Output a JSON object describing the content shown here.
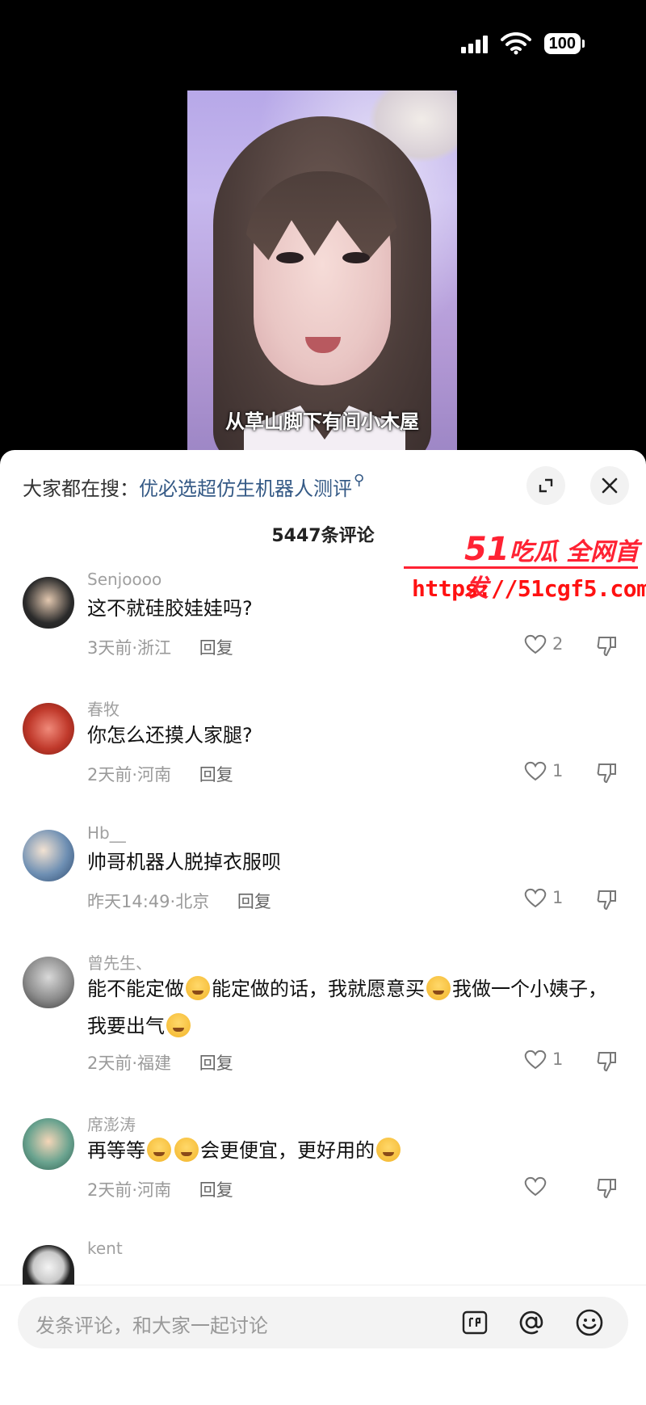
{
  "status": {
    "battery": "100"
  },
  "video": {
    "caption": "从草山脚下有间小木屋"
  },
  "search": {
    "prefix": "大家都在搜：",
    "query": "优必选超仿生机器人测评",
    "search_glyph": "⚲"
  },
  "comments_count": "5447条评论",
  "watermark": {
    "brand_num": "51",
    "brand_text": "吃瓜 全网首发",
    "url": "https://51cgf5.com"
  },
  "comments": [
    {
      "user": "Senjoooo",
      "text": "这不就硅胶娃娃吗?",
      "meta": "3天前·浙江",
      "reply": "回复",
      "likes": "2"
    },
    {
      "user": "春牧",
      "text": "你怎么还摸人家腿?",
      "meta": "2天前·河南",
      "reply": "回复",
      "likes": "1"
    },
    {
      "user": "Hb__",
      "text": "帅哥机器人脱掉衣服呗",
      "meta": "昨天14:49·北京",
      "reply": "回复",
      "likes": "1"
    },
    {
      "user": "曾先生、",
      "text_a": "能不能定做",
      "text_b": "能定做的话，我就愿意买",
      "text_c": "我做一个小姨子，我要出气",
      "meta": "2天前·福建",
      "reply": "回复",
      "likes": "1"
    },
    {
      "user": "席澎涛",
      "text_a": "再等等",
      "text_b": "会更便宜，更好用的",
      "meta": "2天前·河南",
      "reply": "回复",
      "likes": ""
    },
    {
      "user": "kent"
    }
  ],
  "input": {
    "placeholder": "发条评论，和大家一起讨论"
  }
}
